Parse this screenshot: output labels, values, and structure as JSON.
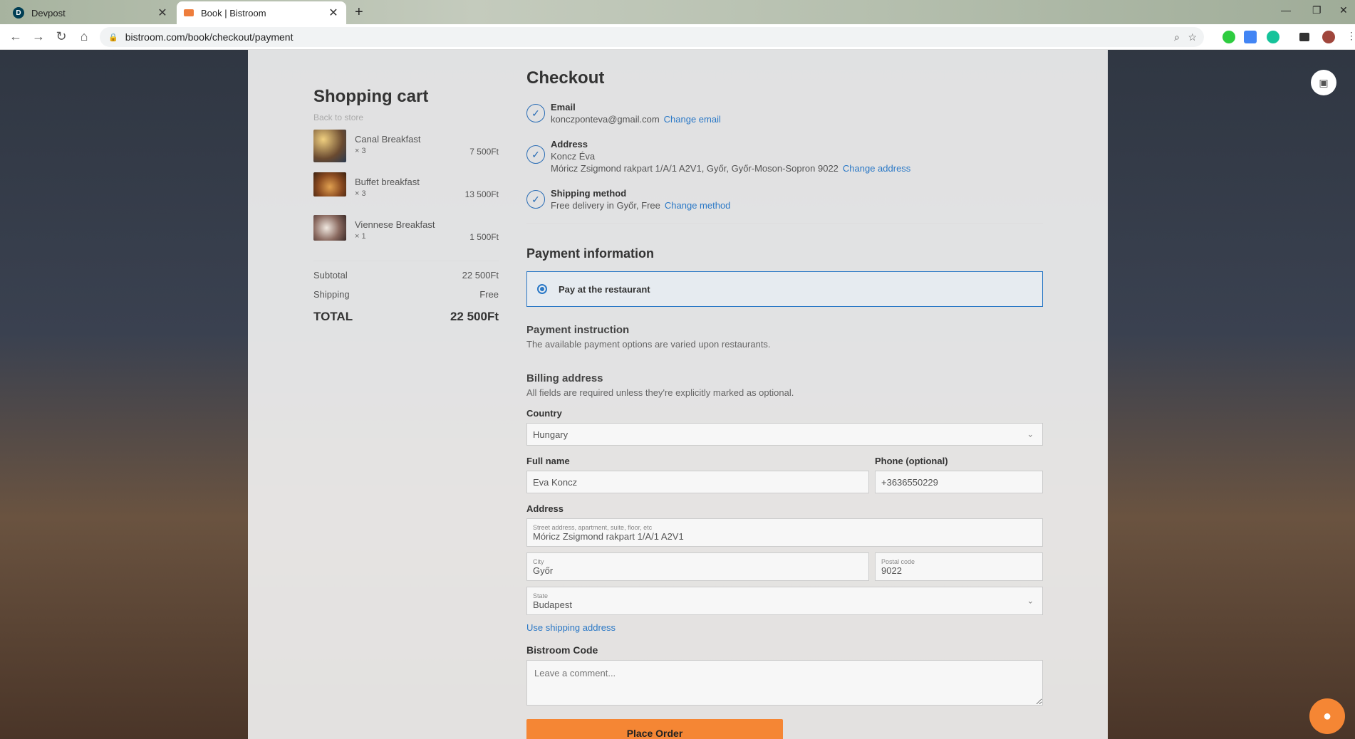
{
  "browser": {
    "tabs": [
      {
        "title": "Devpost",
        "favicon": "D"
      },
      {
        "title": "Book | Bistroom"
      }
    ],
    "url": "bistroom.com/book/checkout/payment"
  },
  "cart": {
    "title": "Shopping cart",
    "back_link": "Back to store",
    "items": [
      {
        "name": "Canal Breakfast",
        "qty": "× 3",
        "price": "7 500Ft"
      },
      {
        "name": "Buffet breakfast",
        "qty": "× 3",
        "price": "13 500Ft"
      },
      {
        "name": "Viennese Breakfast",
        "qty": "× 1",
        "price": "1 500Ft"
      }
    ],
    "subtotal_label": "Subtotal",
    "subtotal": "22 500Ft",
    "shipping_label": "Shipping",
    "shipping": "Free",
    "total_label": "TOTAL",
    "total": "22 500Ft"
  },
  "checkout": {
    "title": "Checkout",
    "email": {
      "label": "Email",
      "value": "konczponteva@gmail.com",
      "link": "Change email"
    },
    "address": {
      "label": "Address",
      "name": "Koncz Éva",
      "line": "Móricz Zsigmond rakpart 1/A/1 A2V1, Győr, Győr-Moson-Sopron 9022",
      "link": "Change address"
    },
    "shipping": {
      "label": "Shipping method",
      "value": "Free delivery in Győr, Free",
      "link": "Change method"
    },
    "payment_title": "Payment information",
    "payment_option": "Pay at the restaurant",
    "instruction_title": "Payment instruction",
    "instruction_text": "The available payment options are varied upon restaurants.",
    "billing_title": "Billing address",
    "billing_note": "All fields are required unless they're explicitly marked as optional.",
    "country_label": "Country",
    "country": "Hungary",
    "fullname_label": "Full name",
    "fullname": "Eva Koncz",
    "phone_label": "Phone (optional)",
    "phone": "+3636550229",
    "address_label": "Address",
    "street_hint": "Street address, apartment, suite, floor, etc",
    "street": "Móricz Zsigmond rakpart 1/A/1 A2V1",
    "city_hint": "City",
    "city": "Győr",
    "postal_hint": "Postal code",
    "postal": "9022",
    "state_hint": "State",
    "state": "Budapest",
    "use_shipping": "Use shipping address",
    "code_label": "Bistroom Code",
    "comment_placeholder": "Leave a comment...",
    "place_order": "Place Order"
  },
  "colors": {
    "accent": "#f58634",
    "link": "#2a78c6"
  }
}
